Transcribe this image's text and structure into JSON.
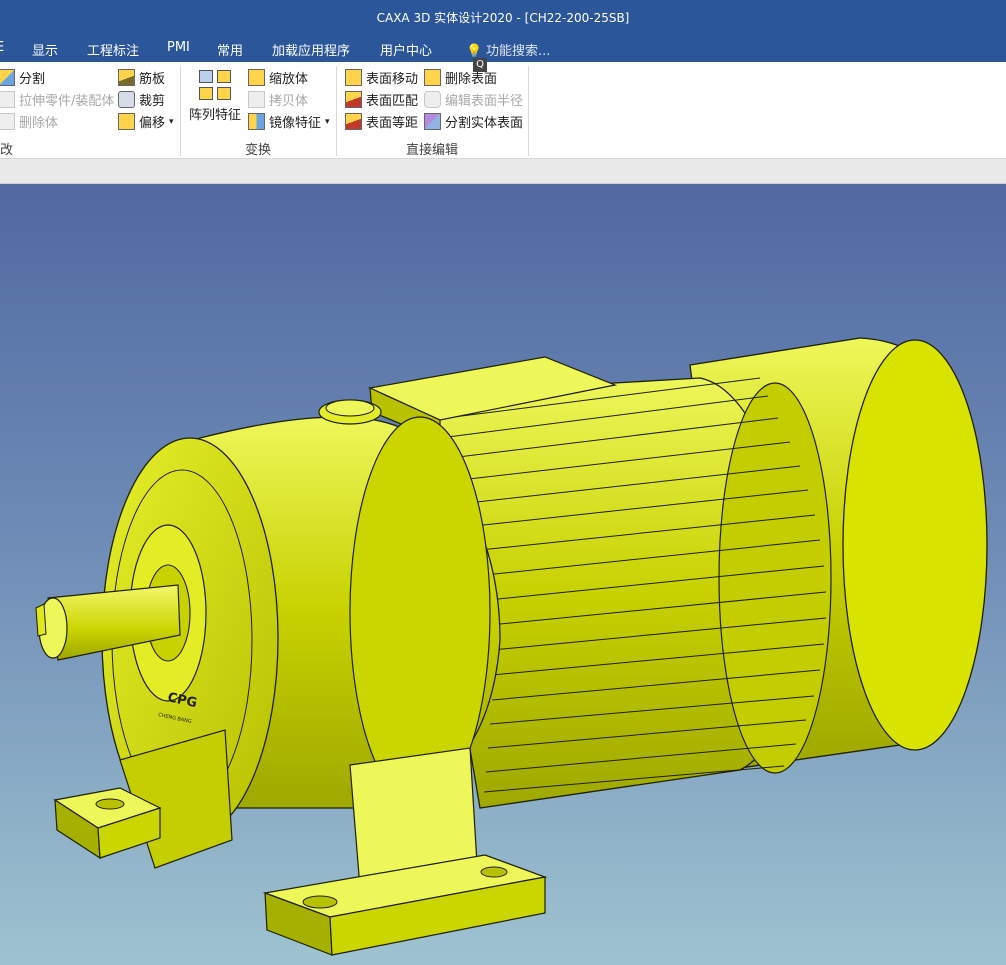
{
  "window": {
    "title": "CAXA 3D 实体设计2020 - [CH22-200-25SB]"
  },
  "menu": {
    "items": [
      "E",
      "显示",
      "工程标注",
      "PMI",
      "常用",
      "加载应用程序",
      "用户中心"
    ],
    "search_placeholder": "功能搜索...",
    "search_badge": "Q"
  },
  "ribbon": {
    "modify": {
      "label": "改",
      "split": "分割",
      "stretch": "拉伸零件/装配体",
      "delete_body": "删除体",
      "rib": "筋板",
      "trim": "裁剪",
      "offset": "偏移"
    },
    "transform": {
      "label": "变换",
      "array": "阵列特征",
      "scale": "缩放体",
      "copy": "拷贝体",
      "mirror": "镜像特征"
    },
    "direct_edit": {
      "label": "直接编辑",
      "move_face": "表面移动",
      "match_face": "表面匹配",
      "offset_face": "表面等距",
      "delete_face": "删除表面",
      "edit_radius": "编辑表面半径",
      "split_face": "分割实体表面"
    }
  },
  "model": {
    "logo_text": "CPG",
    "subtext": "CHENG BANG",
    "colors": {
      "body": "#d8e200",
      "light": "#eef75a",
      "dark": "#8f9a00",
      "edge": "#1f2000"
    }
  }
}
